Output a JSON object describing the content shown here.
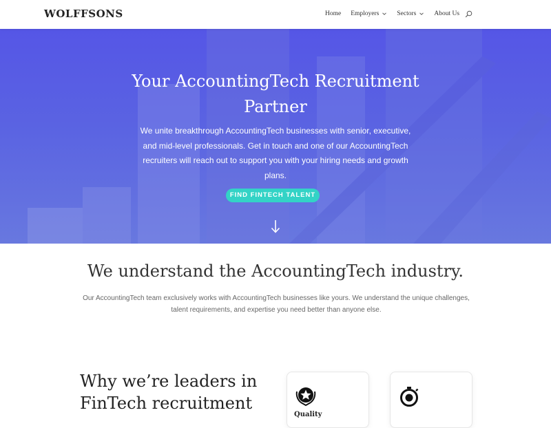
{
  "brand": {
    "logo": "WOLFFSONS"
  },
  "nav": {
    "items": [
      {
        "label": "Home",
        "has_dropdown": false
      },
      {
        "label": "Employers",
        "has_dropdown": true
      },
      {
        "label": "Sectors",
        "has_dropdown": true
      },
      {
        "label": "About Us",
        "has_dropdown": false
      }
    ],
    "search_icon": "search-icon"
  },
  "hero": {
    "title": "Your AccountingTech Recruitment Partner",
    "text": "We unite breakthrough AccountingTech businesses with senior, executive, and mid-level professionals. Get in touch and one of our AccountingTech recruiters will reach out to support you with your hiring needs and growth plans.",
    "cta_label": "FIND FINTECH TALENT",
    "arrow_icon": "arrow-down-icon"
  },
  "understand": {
    "title": "We understand the AccountingTech industry.",
    "text": "Our AccountingTech team exclusively works with AccountingTech businesses like yours. We understand the unique challenges, talent requirements, and expertise you need better than anyone else."
  },
  "why": {
    "title": "Why we’re leaders in FinTech recruitment",
    "cards": [
      {
        "icon": "star-award-icon",
        "label": "Quality"
      },
      {
        "icon": "stopwatch-icon",
        "label": ""
      }
    ]
  },
  "colors": {
    "hero_top": "#5556e6",
    "hero_bottom": "#6878df",
    "cta": "#33d3c6",
    "heading": "#333333"
  }
}
